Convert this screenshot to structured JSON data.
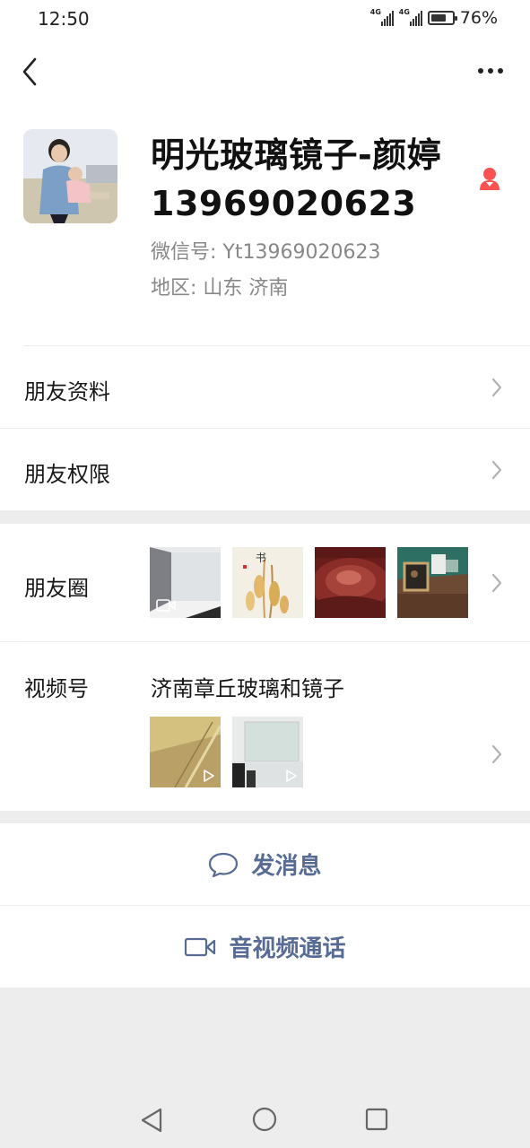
{
  "status_bar": {
    "time": "12:50",
    "network_1": "4G",
    "network_2": "4G",
    "battery_percent": "76%",
    "battery_level": 0.76
  },
  "nav": {
    "back_icon": "chevron-left-icon",
    "more_icon": "more-dots-icon"
  },
  "profile": {
    "name": "明光玻璃镜子-颜婷13969020623",
    "wechat_id": "微信号:  Yt13969020623",
    "region": "地区:  山东  济南",
    "gender_icon": "female-icon",
    "gender_color": "#fa5151"
  },
  "rows": {
    "friend_profile": "朋友资料",
    "friend_permissions": "朋友权限",
    "moments": "朋友圈",
    "channels": "视频号",
    "channels_name": "济南章丘玻璃和镜子"
  },
  "actions": {
    "send_message": "发消息",
    "video_call": "音视频通话"
  },
  "colors": {
    "link_blue": "#576b95",
    "background_gray": "#ededed"
  }
}
